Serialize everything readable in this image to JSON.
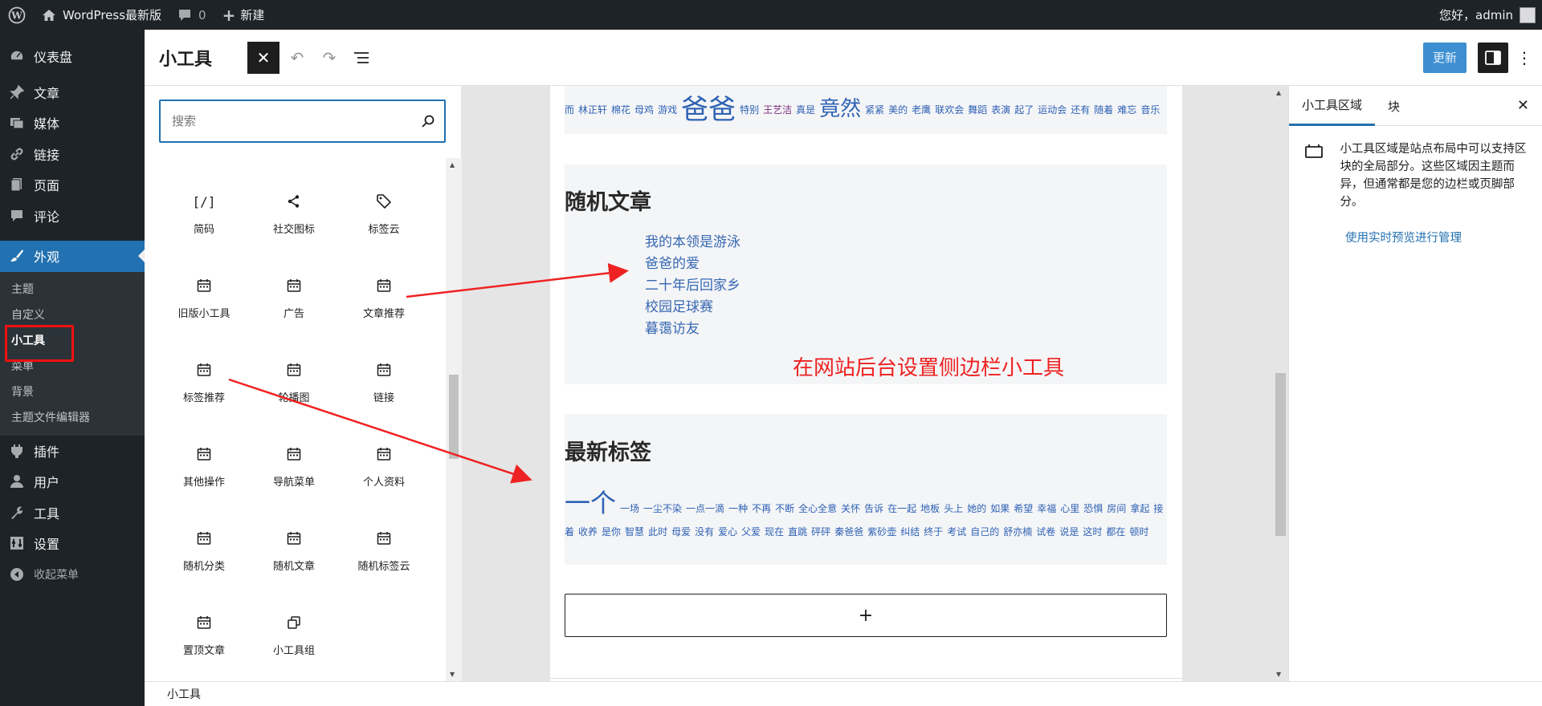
{
  "adminbar": {
    "site_name": "WordPress最新版",
    "comments_count": "0",
    "new_label": "新建",
    "greeting": "您好，admin"
  },
  "sidebar": {
    "items": [
      {
        "label": "仪表盘",
        "icon": "dashboard-icon"
      },
      {
        "label": "文章",
        "icon": "pushpin-icon"
      },
      {
        "label": "媒体",
        "icon": "media-icon"
      },
      {
        "label": "链接",
        "icon": "link-icon"
      },
      {
        "label": "页面",
        "icon": "page-icon"
      },
      {
        "label": "评论",
        "icon": "comment-icon"
      },
      {
        "label": "外观",
        "icon": "paintbrush-icon"
      }
    ],
    "appearance_sub": [
      "主题",
      "自定义",
      "小工具",
      "菜单",
      "背景",
      "主题文件编辑器"
    ],
    "items_after": [
      {
        "label": "插件",
        "icon": "plugin-icon"
      },
      {
        "label": "用户",
        "icon": "user-icon"
      },
      {
        "label": "工具",
        "icon": "wrench-icon"
      },
      {
        "label": "设置",
        "icon": "settings-icon"
      },
      {
        "label": "收起菜单",
        "icon": "collapse-icon"
      }
    ]
  },
  "header": {
    "title": "小工具",
    "update_label": "更新"
  },
  "inserter": {
    "search_placeholder": "搜索",
    "blocks": [
      {
        "label": "简码",
        "icon": "shortcode-icon"
      },
      {
        "label": "社交图标",
        "icon": "share-icon"
      },
      {
        "label": "标签云",
        "icon": "tag-icon"
      },
      {
        "label": "旧版小工具",
        "icon": "calendar-icon"
      },
      {
        "label": "广告",
        "icon": "calendar-icon"
      },
      {
        "label": "文章推荐",
        "icon": "calendar-icon"
      },
      {
        "label": "标签推荐",
        "icon": "calendar-icon"
      },
      {
        "label": "轮播图",
        "icon": "calendar-icon"
      },
      {
        "label": "链接",
        "icon": "calendar-icon"
      },
      {
        "label": "其他操作",
        "icon": "calendar-icon"
      },
      {
        "label": "导航菜单",
        "icon": "calendar-icon"
      },
      {
        "label": "个人资料",
        "icon": "calendar-icon"
      },
      {
        "label": "随机分类",
        "icon": "calendar-icon"
      },
      {
        "label": "随机文章",
        "icon": "calendar-icon"
      },
      {
        "label": "随机标签云",
        "icon": "calendar-icon"
      },
      {
        "label": "置顶文章",
        "icon": "calendar-icon"
      },
      {
        "label": "小工具组",
        "icon": "group-icon"
      }
    ]
  },
  "canvas": {
    "top_tags": [
      {
        "t": "而",
        "s": 12
      },
      {
        "t": "林正轩",
        "s": 12
      },
      {
        "t": "棉花",
        "s": 12
      },
      {
        "t": "母鸡",
        "s": 12
      },
      {
        "t": "游戏",
        "s": 12
      },
      {
        "t": "爸爸",
        "s": 34
      },
      {
        "t": "特别",
        "s": 12
      },
      {
        "t": "王艺洁",
        "s": 12,
        "c": "#7a2a7a"
      },
      {
        "t": "真是",
        "s": 12
      },
      {
        "t": "竟然",
        "s": 26
      },
      {
        "t": "紧紧",
        "s": 12
      },
      {
        "t": "美的",
        "s": 12
      },
      {
        "t": "老鹰",
        "s": 12
      },
      {
        "t": "联欢会",
        "s": 12
      },
      {
        "t": "舞蹈",
        "s": 12
      },
      {
        "t": "表演",
        "s": 12
      },
      {
        "t": "起了",
        "s": 12
      },
      {
        "t": "运动会",
        "s": 12
      },
      {
        "t": "还有",
        "s": 12
      },
      {
        "t": "随着",
        "s": 12
      },
      {
        "t": "难忘",
        "s": 12
      },
      {
        "t": "音乐",
        "s": 12
      }
    ],
    "random_posts_title": "随机文章",
    "random_posts": [
      "我的本领是游泳",
      "爸爸的爱",
      "二十年后回家乡",
      "校园足球赛",
      "暮霭访友"
    ],
    "annotation": "在网站后台设置侧边栏小工具",
    "latest_tags_title": "最新标签",
    "latest_tags_line1": [
      {
        "t": "一个",
        "s": 32
      },
      {
        "t": "一场",
        "s": 12
      },
      {
        "t": "一尘不染",
        "s": 12
      },
      {
        "t": "一点一滴",
        "s": 12
      },
      {
        "t": "一种",
        "s": 12
      },
      {
        "t": "不再",
        "s": 12
      },
      {
        "t": "不断",
        "s": 12
      },
      {
        "t": "全心全意",
        "s": 12
      },
      {
        "t": "关怀",
        "s": 12
      },
      {
        "t": "告诉",
        "s": 12
      },
      {
        "t": "在一起",
        "s": 12
      },
      {
        "t": "地板",
        "s": 12
      },
      {
        "t": "头上",
        "s": 12
      },
      {
        "t": "她的",
        "s": 12
      },
      {
        "t": "如果",
        "s": 12
      },
      {
        "t": "希望",
        "s": 12
      },
      {
        "t": "幸福",
        "s": 12
      },
      {
        "t": "心里",
        "s": 12
      },
      {
        "t": "恐惧",
        "s": 12
      },
      {
        "t": "房间",
        "s": 12
      },
      {
        "t": "拿起",
        "s": 12
      },
      {
        "t": "接",
        "s": 12
      }
    ],
    "latest_tags_line2": [
      {
        "t": "着",
        "s": 12
      },
      {
        "t": "收养",
        "s": 12
      },
      {
        "t": "是你",
        "s": 12
      },
      {
        "t": "智慧",
        "s": 12
      },
      {
        "t": "此时",
        "s": 12
      },
      {
        "t": "母爱",
        "s": 12
      },
      {
        "t": "没有",
        "s": 12
      },
      {
        "t": "爱心",
        "s": 12
      },
      {
        "t": "父爱",
        "s": 12
      },
      {
        "t": "现在",
        "s": 12
      },
      {
        "t": "直跳",
        "s": 12
      },
      {
        "t": "砰砰",
        "s": 12
      },
      {
        "t": "秦爸爸",
        "s": 12
      },
      {
        "t": "紫砂壶",
        "s": 12
      },
      {
        "t": "纠结",
        "s": 12
      },
      {
        "t": "终于",
        "s": 12
      },
      {
        "t": "考试",
        "s": 12
      },
      {
        "t": "自己的",
        "s": 12
      },
      {
        "t": "舒亦楠",
        "s": 12
      },
      {
        "t": "试卷",
        "s": 12
      },
      {
        "t": "说是",
        "s": 12
      },
      {
        "t": "这时",
        "s": 12
      },
      {
        "t": "都在",
        "s": 12
      },
      {
        "t": "顿时",
        "s": 12
      }
    ],
    "add_block": "+"
  },
  "settings": {
    "tab_areas": "小工具区域",
    "tab_block": "块",
    "description": "小工具区域是站点布局中可以支持区块的全局部分。这些区域因主题而异，但通常都是您的边栏或页脚部分。",
    "manage_link": "使用实时预览进行管理"
  },
  "footer": {
    "breadcrumb": "小工具"
  },
  "colors": {
    "accent": "#2271b1",
    "admin_dark": "#1d2327",
    "annotation_red": "#e22222",
    "tag_blue": "#2e62b5"
  }
}
